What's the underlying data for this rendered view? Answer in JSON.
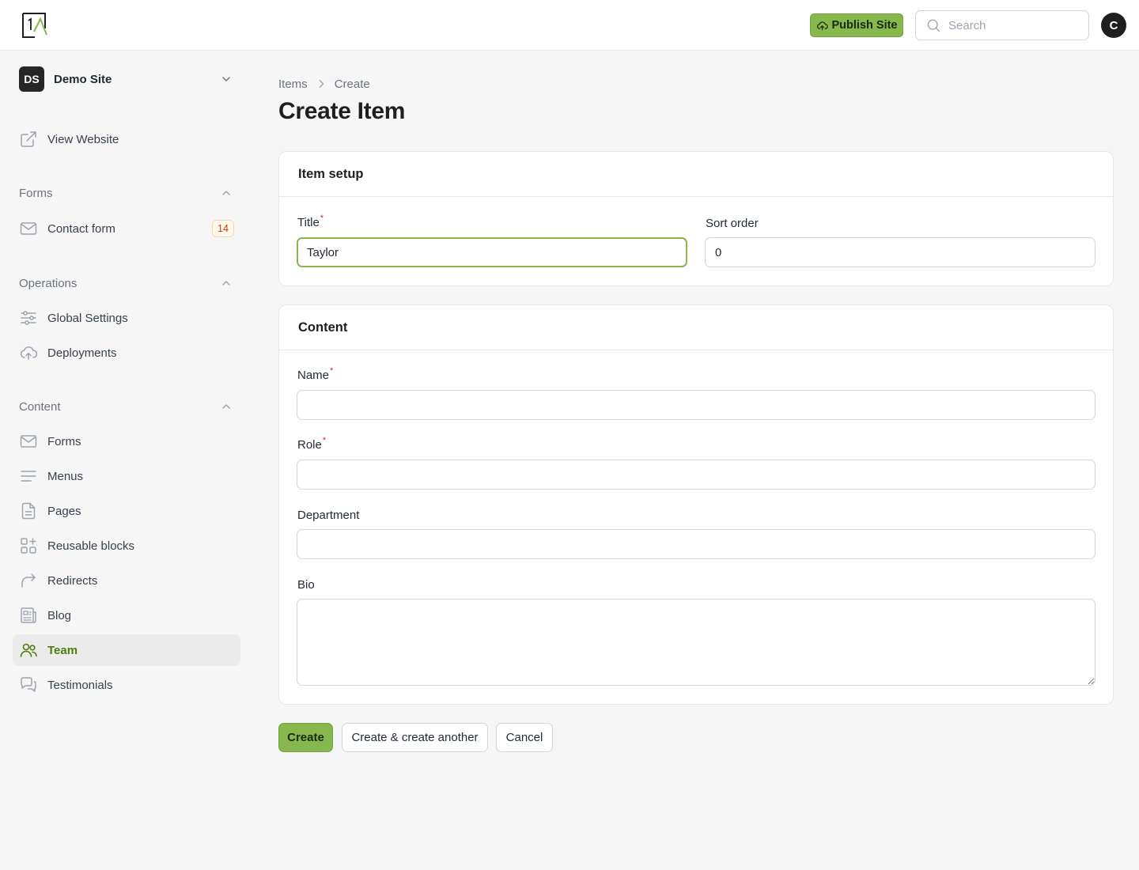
{
  "header": {
    "publish_label": "Publish Site",
    "search_placeholder": "Search",
    "avatar_initial": "C",
    "accent_color": "#86b84e"
  },
  "sidebar": {
    "site": {
      "initials": "DS",
      "name": "Demo Site"
    },
    "view_website": "View Website",
    "groups": {
      "forms": {
        "label": "Forms",
        "items": [
          {
            "label": "Contact form",
            "count": "14"
          }
        ]
      },
      "operations": {
        "label": "Operations",
        "items": [
          {
            "label": "Global Settings"
          },
          {
            "label": "Deployments"
          }
        ]
      },
      "content": {
        "label": "Content",
        "items": [
          {
            "label": "Forms"
          },
          {
            "label": "Menus"
          },
          {
            "label": "Pages"
          },
          {
            "label": "Reusable blocks"
          },
          {
            "label": "Redirects"
          },
          {
            "label": "Blog"
          },
          {
            "label": "Team",
            "active": true
          },
          {
            "label": "Testimonials"
          }
        ]
      }
    }
  },
  "main": {
    "breadcrumb": [
      "Items",
      "Create"
    ],
    "title": "Create Item",
    "setup_card": {
      "title": "Item setup",
      "title_label": "Title",
      "title_value": "Taylor",
      "sort_label": "Sort order",
      "sort_value": "0"
    },
    "content_card": {
      "title": "Content",
      "name_label": "Name",
      "name_value": "",
      "role_label": "Role",
      "role_value": "",
      "department_label": "Department",
      "department_value": "",
      "bio_label": "Bio",
      "bio_value": ""
    },
    "actions": {
      "create": "Create",
      "create_another": "Create & create another",
      "cancel": "Cancel"
    }
  }
}
